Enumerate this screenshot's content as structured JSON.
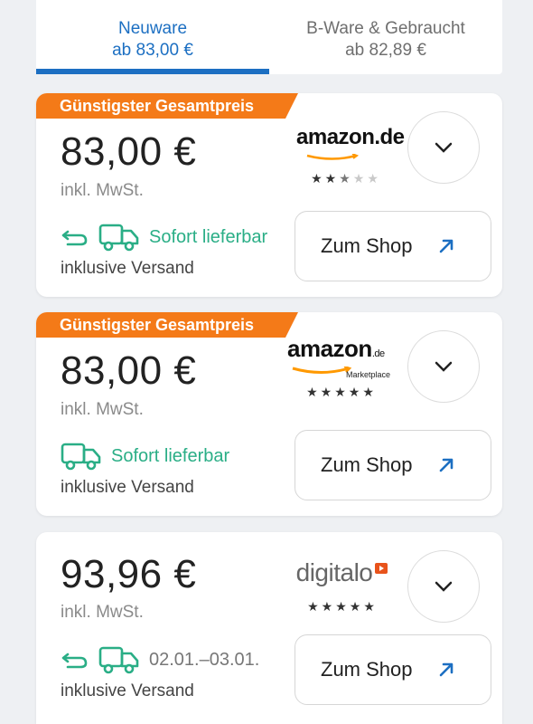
{
  "tabs": [
    {
      "title": "Neuware",
      "subtitle": "ab 83,00 €",
      "active": true
    },
    {
      "title": "B-Ware & Gebraucht",
      "subtitle": "ab 82,89 €",
      "active": false
    }
  ],
  "offers": [
    {
      "badge": "Günstigster Gesamtpreis",
      "price": "83,00 €",
      "vat": "inkl. MwSt.",
      "shop_logo_text": "amazon.de",
      "rating_stars": 2.5,
      "delivery_text": "Sofort lieferbar",
      "return_icon": true,
      "shipping": "inklusive Versand",
      "shop_button": "Zum Shop"
    },
    {
      "badge": "Günstigster Gesamtpreis",
      "price": "83,00 €",
      "vat": "inkl. MwSt.",
      "shop_logo_text": "amazon",
      "shop_logo_suffix": ".de",
      "shop_logo_sub": "Marketplace",
      "rating_stars": 5,
      "delivery_text": "Sofort lieferbar",
      "return_icon": false,
      "shipping": "inklusive Versand",
      "shop_button": "Zum Shop"
    },
    {
      "badge": "",
      "price": "93,96 €",
      "vat": "inkl. MwSt.",
      "shop_logo_text": "digitalo",
      "rating_stars": 5,
      "delivery_text": "02.01.–03.01.",
      "return_icon": true,
      "shipping": "inklusive Versand",
      "shop_button": "Zum Shop"
    }
  ],
  "colors": {
    "accent_blue": "#1c6fc2",
    "badge_orange": "#f47a18",
    "delivery_green": "#2aae86",
    "amazon_orange": "#ff9900",
    "digitalo_orange": "#e8531b"
  }
}
